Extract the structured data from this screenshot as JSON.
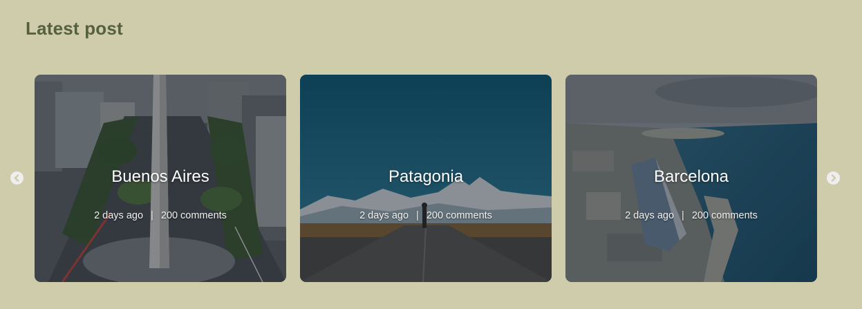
{
  "section": {
    "title": "Latest post"
  },
  "carousel": {
    "prev_icon": "chevron-left-icon",
    "next_icon": "chevron-right-icon",
    "posts": [
      {
        "title": "Buenos Aires",
        "date": "2 days ago",
        "separator": "|",
        "comments": "200 comments",
        "image": "city-obelisk-photo"
      },
      {
        "title": "Patagonia",
        "date": "2 days ago",
        "separator": "|",
        "comments": "200 comments",
        "image": "mountain-road-photo"
      },
      {
        "title": "Barcelona",
        "date": "2 days ago",
        "separator": "|",
        "comments": "200 comments",
        "image": "coastal-city-photo"
      }
    ]
  },
  "colors": {
    "background": "#cfccac",
    "title": "#56603f",
    "card_text": "#ffffff"
  }
}
